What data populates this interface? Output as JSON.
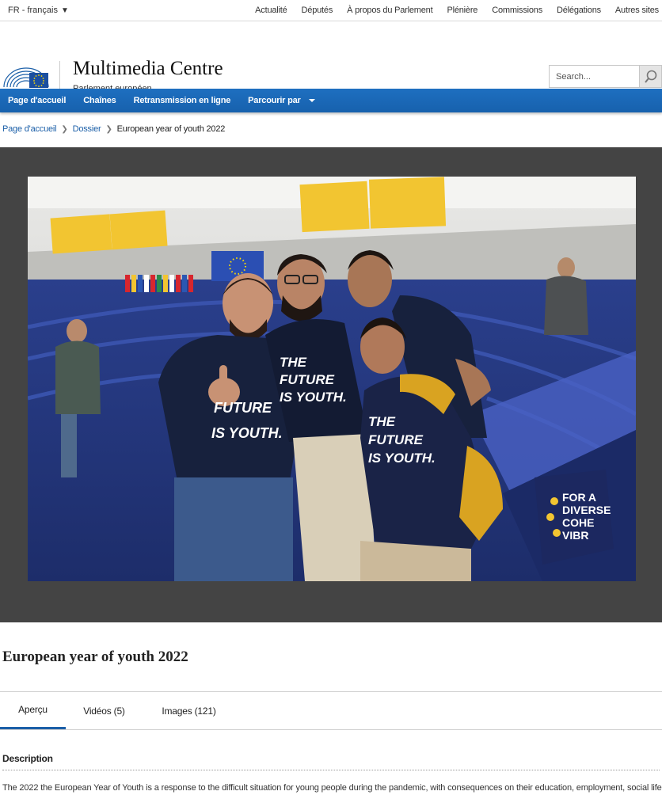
{
  "topbar": {
    "language": "FR - français",
    "links": [
      "Actualité",
      "Députés",
      "À propos du Parlement",
      "Plénière",
      "Commissions",
      "Délégations",
      "Autres sites"
    ]
  },
  "header": {
    "title": "Multimedia Centre",
    "subtitle": "Parlement européen",
    "search_placeholder": "Search..."
  },
  "nav": {
    "items": [
      "Page d'accueil",
      "Chaînes",
      "Retransmission en ligne",
      "Parcourir par"
    ]
  },
  "breadcrumb": {
    "items": [
      "Page d'accueil",
      "Dossier"
    ],
    "current": "European year of youth 2022"
  },
  "photo": {
    "description_icons": "photo-of-four-young-men-in-hemicycle",
    "shirt_text": [
      "THE",
      "FUTURE",
      "IS YOUTH."
    ],
    "banner_text": [
      "FOR A",
      "DIVERSE",
      "COHE",
      "VIBR"
    ]
  },
  "page": {
    "title": "European year of youth 2022"
  },
  "tabs": [
    {
      "label": "Aperçu",
      "active": true
    },
    {
      "label": "Vidéos (5)",
      "active": false
    },
    {
      "label": "Images (121)",
      "active": false
    }
  ],
  "description": {
    "heading": "Description",
    "text": "The 2022 the European Year of Youth is a response to the difficult situation for young people during the pandemic, with consequences on their education, employment, social life,"
  },
  "colors": {
    "nav_blue": "#1b68b6",
    "link_blue": "#1b5fa8",
    "media_bg": "#444444"
  }
}
